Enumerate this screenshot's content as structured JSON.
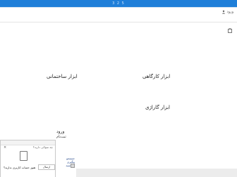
{
  "header": {
    "nav_text": "3 2 5"
  },
  "account": {
    "login_label": "ورود"
  },
  "categories": {
    "structural": "ابزار ساختمانی",
    "workshop": "ابزار کارگاهی",
    "garage": "ابزار گاراژی"
  },
  "login_box": {
    "title": "ورود",
    "subtitle": "ثبت‌نام",
    "stack_1": "جستجو",
    "stack_2": "پیگیری",
    "stack_3": "سبد"
  },
  "chat": {
    "close_label": "×",
    "question": "چه سوالی دارید؟",
    "prompt": "هنوز حساب کاربری ندارید؟",
    "send_label": "ارسال"
  },
  "colors": {
    "topbar": "#1f7fd9"
  }
}
